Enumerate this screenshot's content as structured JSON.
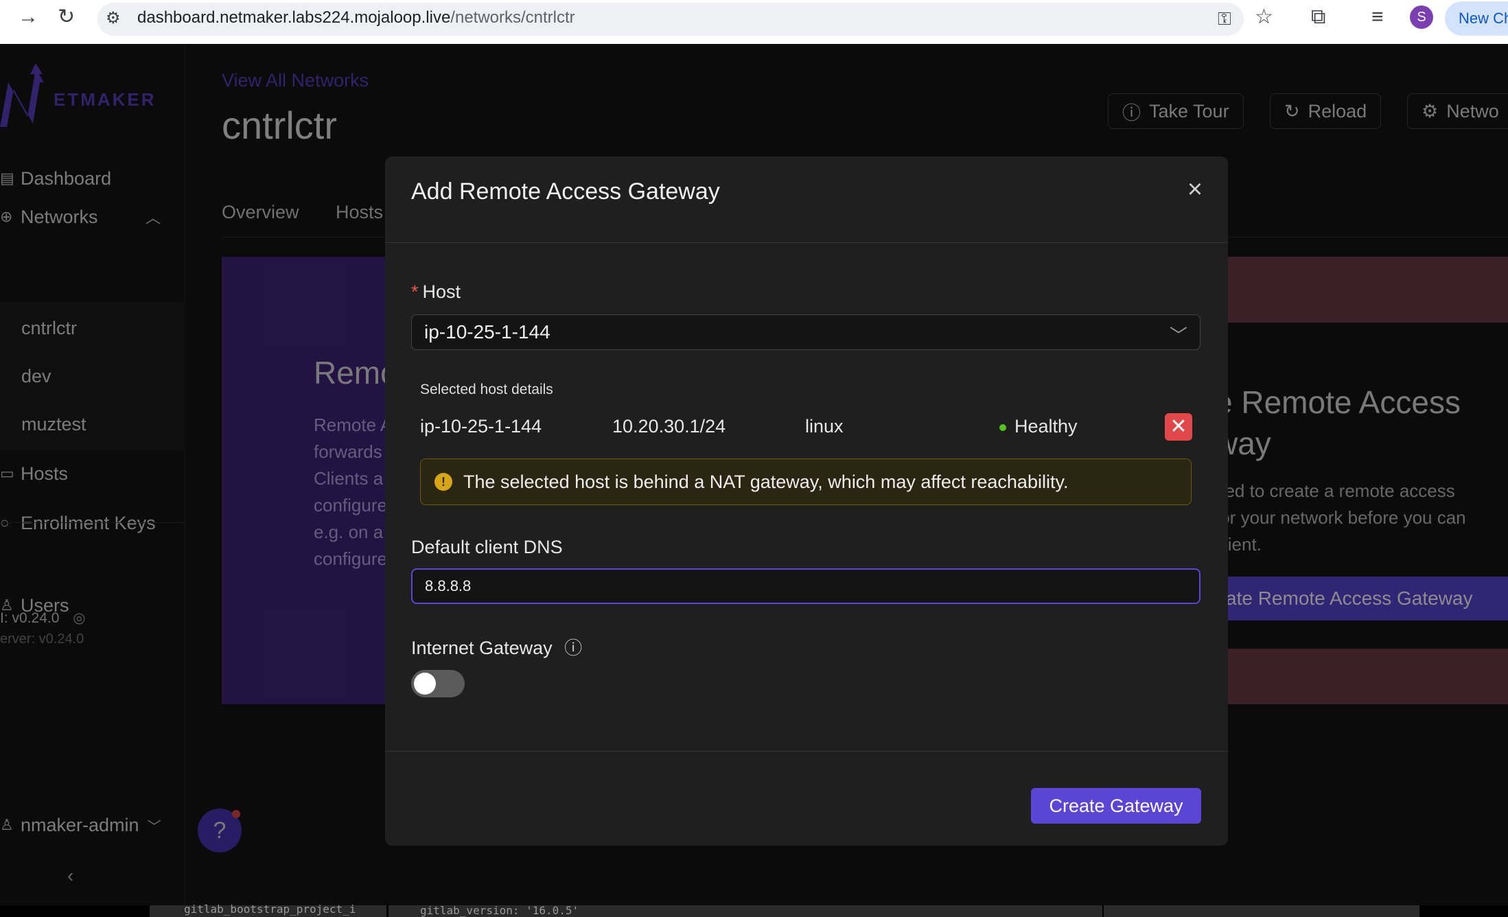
{
  "browser": {
    "url_host": "dashboard.netmaker.labs224.mojaloop.live",
    "url_path": "/networks/cntrlctr",
    "profile_initial": "S",
    "new_chrome_label": "New Ch"
  },
  "sidebar": {
    "logo_text": "ETMAKER",
    "items": [
      {
        "label": "Dashboard",
        "icon": "dashboard-icon"
      },
      {
        "label": "Networks",
        "icon": "globe-icon"
      },
      {
        "label": "Hosts",
        "icon": "laptop-icon"
      },
      {
        "label": "Enrollment Keys",
        "icon": "key-icon"
      },
      {
        "label": "Users",
        "icon": "user-icon"
      }
    ],
    "networks": [
      "cntrlctr",
      "dev",
      "muztest"
    ],
    "ui_version": "I: v0.24.0",
    "server_version": "erver: v0.24.0",
    "username": "nmaker-admin"
  },
  "main": {
    "view_all": "View All Networks",
    "network_title": "cntrlctr",
    "tabs": [
      "Overview",
      "Hosts"
    ],
    "buttons": {
      "tour": "Take Tour",
      "reload": "Reload",
      "network": "Netwo"
    },
    "bg_left_heading": "Remo",
    "bg_left_lines": [
      "Remote A",
      "forwards",
      "Clients a",
      "configure",
      "e.g. on a",
      "configure"
    ],
    "bg_right_heading_1": "e Remote Access",
    "bg_right_heading_2": "way",
    "bg_right_lines": [
      "eed to create a remote access",
      "for your network before you can",
      "client."
    ],
    "bg_right_button": "ate Remote Access Gateway"
  },
  "modal": {
    "title": "Add Remote Access Gateway",
    "host_label": "Host",
    "host_selected": "ip-10-25-1-144",
    "details_label": "Selected host details",
    "detail_name": "ip-10-25-1-144",
    "detail_ip": "10.20.30.1/24",
    "detail_os": "linux",
    "detail_status": "Healthy",
    "warning": "The selected host is behind a NAT gateway, which may affect reachability.",
    "dns_label": "Default client DNS",
    "dns_value": "8.8.8.8",
    "internet_gateway_label": "Internet Gateway",
    "internet_gateway_on": false,
    "create_button": "Create Gateway"
  },
  "bottom_strip": {
    "text_a": "gitlab_bootstrap_project_i",
    "text_b": "gitlab_version: '16.0.5'"
  },
  "colors": {
    "accent": "#5a45d6",
    "link": "#5b3fc4",
    "healthy": "#52c41a",
    "danger": "#e0484a",
    "warning": "#d8a614"
  }
}
